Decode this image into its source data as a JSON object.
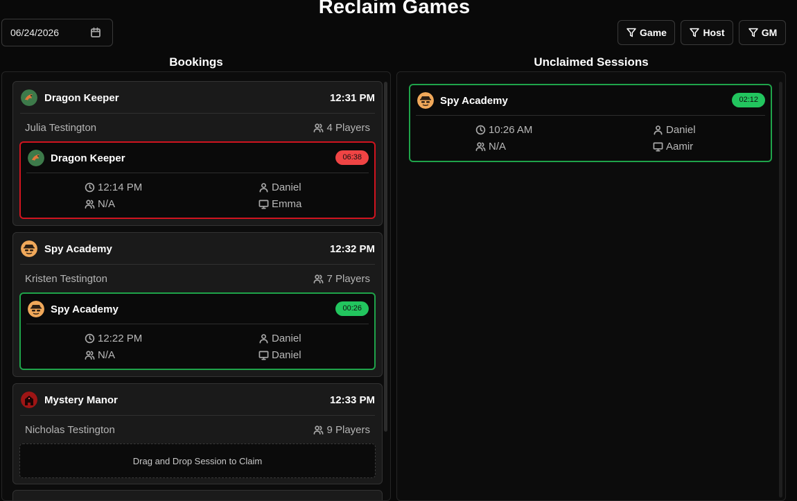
{
  "page": {
    "title": "Reclaim Games"
  },
  "date_input": {
    "value": "06/24/2026"
  },
  "filters": [
    {
      "label": "Game"
    },
    {
      "label": "Host"
    },
    {
      "label": "GM"
    }
  ],
  "columns": {
    "bookings": "Bookings",
    "unclaimed": "Unclaimed Sessions"
  },
  "bookings": [
    {
      "game": "Dragon Keeper",
      "time": "12:31 PM",
      "customer": "Julia Testington",
      "players": "4 Players",
      "icon": "dragon-icon",
      "session": {
        "game": "Dragon Keeper",
        "badge": "06:38",
        "status": "overdue",
        "time": "12:14 PM",
        "host": "Daniel",
        "players": "N/A",
        "gm": "Emma"
      }
    },
    {
      "game": "Spy Academy",
      "time": "12:32 PM",
      "customer": "Kristen Testington",
      "players": "7 Players",
      "icon": "spy-icon",
      "session": {
        "game": "Spy Academy",
        "badge": "00:26",
        "status": "ok",
        "time": "12:22 PM",
        "host": "Daniel",
        "players": "N/A",
        "gm": "Daniel"
      }
    },
    {
      "game": "Mystery Manor",
      "time": "12:33 PM",
      "customer": "Nicholas Testington",
      "players": "9 Players",
      "icon": "haunted-house-icon",
      "dropzone": "Drag and Drop Session to Claim"
    }
  ],
  "unclaimed": [
    {
      "game": "Spy Academy",
      "badge": "02:12",
      "status": "ok",
      "time": "10:26 AM",
      "host": "Daniel",
      "players": "N/A",
      "gm": "Aamir",
      "icon": "spy-icon"
    }
  ],
  "colors": {
    "ok": "#22c55e",
    "overdue": "#ef4444",
    "ok_border": "#1fa44a",
    "overdue_border": "#d1141f"
  }
}
